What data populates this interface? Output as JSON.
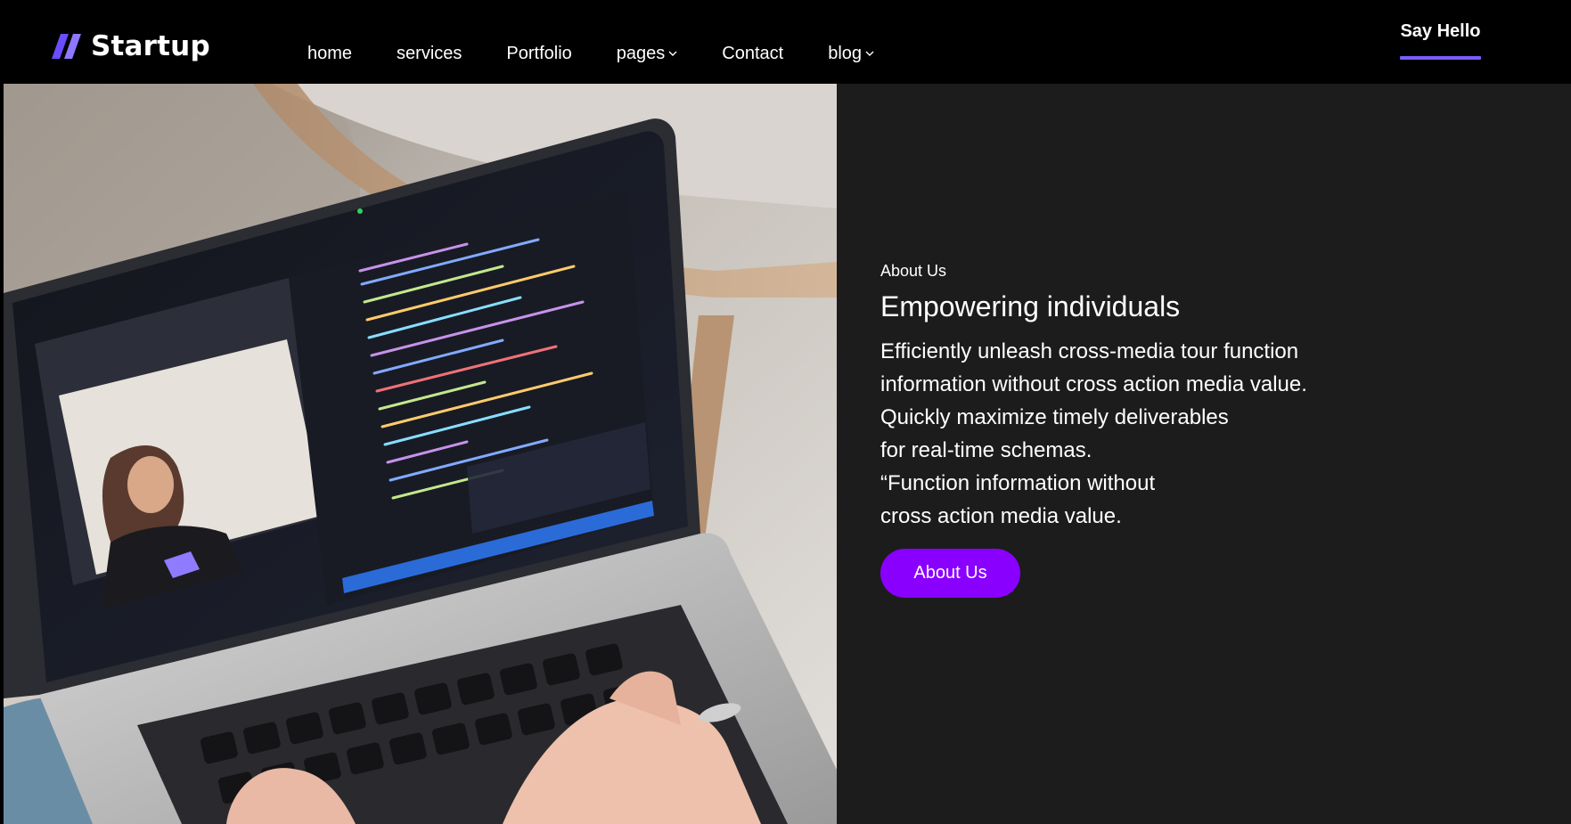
{
  "navbar": {
    "brand": {
      "name": "Startup",
      "icon": "slash-logo-icon",
      "color": "#7c5cff"
    },
    "menu": [
      {
        "label": "home",
        "has_dropdown": false
      },
      {
        "label": "services",
        "has_dropdown": false
      },
      {
        "label": "Portfolio",
        "has_dropdown": false
      },
      {
        "label": "pages",
        "has_dropdown": true
      },
      {
        "label": "Contact",
        "has_dropdown": false
      },
      {
        "label": "blog",
        "has_dropdown": true
      }
    ],
    "cta": {
      "label": "Say Hello",
      "underline_color": "#7c5cff"
    }
  },
  "hero": {
    "image": {
      "subject": "laptop-code-video-call-photo"
    },
    "eyebrow": "About Us",
    "headline": "Empowering individuals",
    "body_lines": [
      "Efficiently unleash cross-media tour function",
      "information without cross action media value.",
      "Quickly maximize timely deliverables",
      "for real-time schemas.",
      "“Function information without",
      "cross action media value."
    ],
    "button": {
      "label": "About Us",
      "color": "#8a00ff"
    },
    "panel_color": "#1c1c1c"
  }
}
